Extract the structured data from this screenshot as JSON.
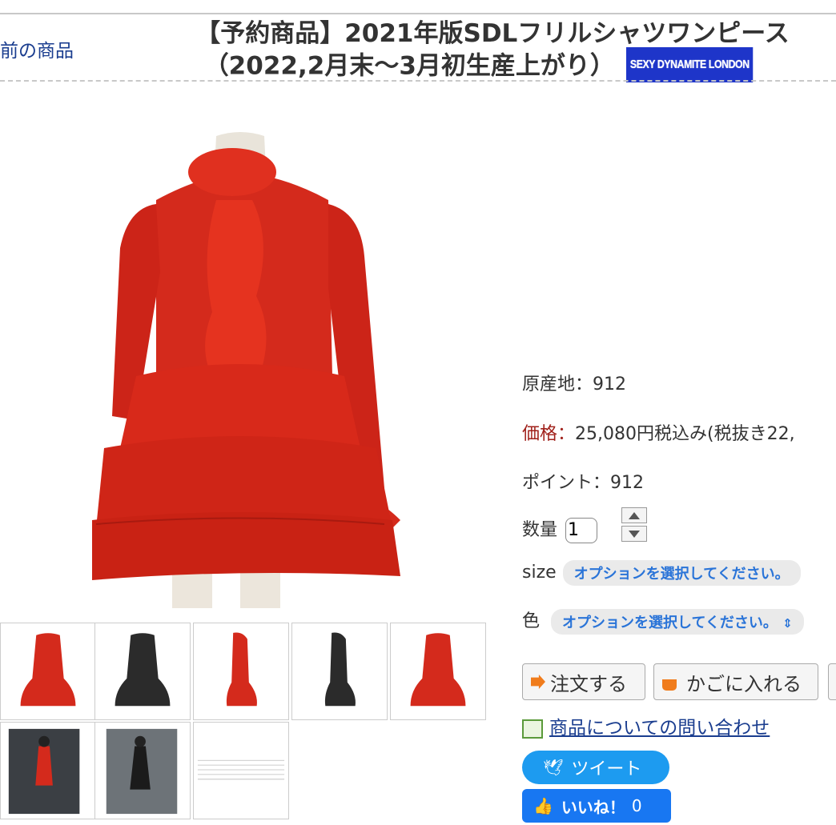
{
  "nav": {
    "prev_label": "前の商品"
  },
  "product": {
    "title_line1": "【予約商品】2021年版SDLフリルシャツワンピース",
    "title_line2": "（2022,2月末〜3月初生産上がり）",
    "brand_badge": "SEXY DYNAMITE LONDON"
  },
  "details": {
    "origin_label": "原産地：",
    "origin_value": "912",
    "price_label": "価格：",
    "price_value": "25,080円税込み(税抜き22,",
    "points_label": "ポイント：",
    "points_value": "912",
    "qty_label": "数量",
    "qty_value": "1",
    "size_label": "size",
    "size_select": "オプションを選択してください。",
    "color_label": "色",
    "color_select": "オプションを選択してください。"
  },
  "actions": {
    "order_label": "注文する",
    "cart_label": "かごに入れる",
    "inquiry_label": "商品についての問い合わせ",
    "tweet_label": "ツイート",
    "like_label": "いいね！",
    "like_count": "0"
  },
  "thumbnails": [
    "red-front",
    "black-front",
    "red-side",
    "black-side",
    "red-back",
    "photo-red-model",
    "photo-black-model",
    "size-chart"
  ],
  "colors": {
    "accent_red": "#d42a1c",
    "link_blue": "#1a3d8f",
    "option_blue": "#2a74d8",
    "twitter": "#1d9bf0",
    "facebook": "#1877f2",
    "badge_blue": "#1e35c9"
  }
}
